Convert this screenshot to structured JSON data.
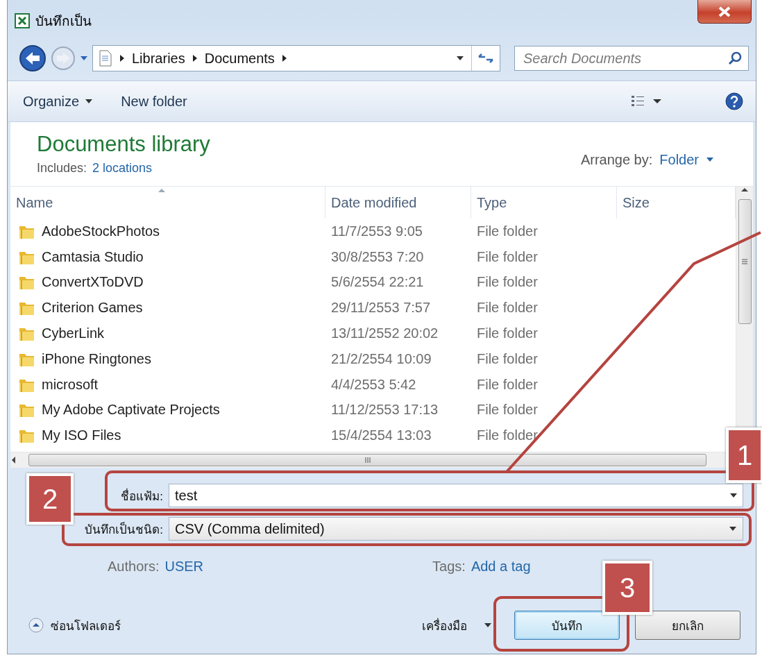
{
  "window": {
    "title": "บันทึกเป็น"
  },
  "address": {
    "path": [
      "Libraries",
      "Documents"
    ]
  },
  "search": {
    "placeholder": "Search Documents"
  },
  "toolbar": {
    "organize": "Organize",
    "new_folder": "New folder"
  },
  "library": {
    "title": "Documents library",
    "includes_label": "Includes:",
    "includes_link": "2 locations",
    "arrange_label": "Arrange by:",
    "arrange_value": "Folder"
  },
  "table": {
    "columns": [
      "Name",
      "Date modified",
      "Type",
      "Size"
    ],
    "rows": [
      {
        "name": "AdobeStockPhotos",
        "date": "11/7/2553 9:05",
        "type": "File folder"
      },
      {
        "name": "Camtasia Studio",
        "date": "30/8/2553 7:20",
        "type": "File folder"
      },
      {
        "name": "ConvertXToDVD",
        "date": "5/6/2554 22:21",
        "type": "File folder"
      },
      {
        "name": "Criterion Games",
        "date": "29/11/2553 7:57",
        "type": "File folder"
      },
      {
        "name": "CyberLink",
        "date": "13/11/2552 20:02",
        "type": "File folder"
      },
      {
        "name": "iPhone Ringtones",
        "date": "21/2/2554 10:09",
        "type": "File folder"
      },
      {
        "name": "microsoft",
        "date": "4/4/2553 5:42",
        "type": "File folder"
      },
      {
        "name": "My Adobe Captivate Projects",
        "date": "11/12/2553 17:13",
        "type": "File folder"
      },
      {
        "name": "My ISO Files",
        "date": "15/4/2554 13:03",
        "type": "File folder"
      }
    ]
  },
  "form": {
    "filename_label": "ชื่อแฟ้ม:",
    "filename": "test",
    "type_label": "บันทึกเป็นชนิด:",
    "type_value": "CSV (Comma delimited)",
    "authors_label": "Authors:",
    "authors": "USER",
    "tags_label": "Tags:",
    "tags": "Add a tag"
  },
  "footer": {
    "hide_folders": "ซ่อนโฟลเดอร์",
    "tools": "เครื่องมือ",
    "save": "บันทึก",
    "cancel": "ยกเลิก"
  },
  "annotations": [
    {
      "label": "1"
    },
    {
      "label": "2"
    },
    {
      "label": "3"
    }
  ]
}
